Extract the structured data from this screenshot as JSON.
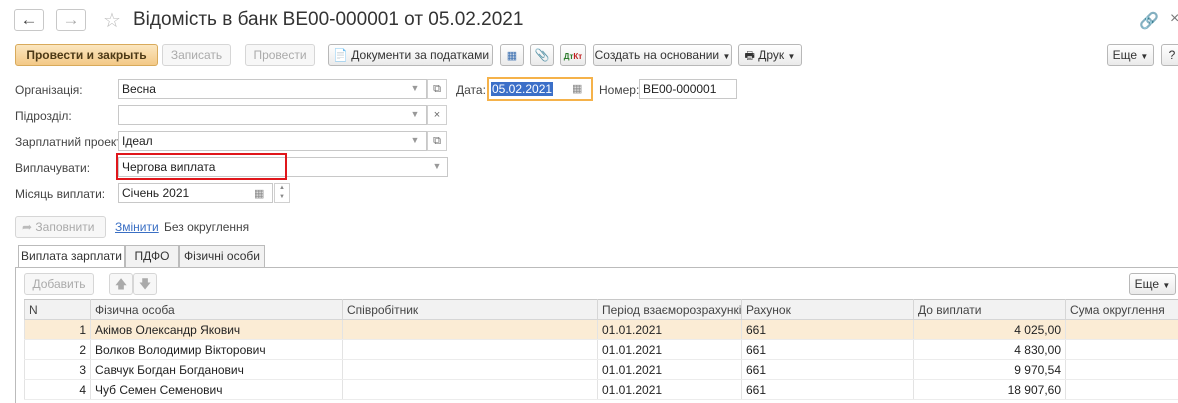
{
  "window": {
    "title": "Відомість в банк ВЕ00-000001 от 05.02.2021"
  },
  "toolbar": {
    "post_close": "Провести и закрыть",
    "save": "Записать",
    "post": "Провести",
    "tax_docs": "Документи за податками",
    "create_based": "Создать на основании",
    "print": "Друк",
    "more": "Еще",
    "help": "?"
  },
  "form": {
    "org_label": "Організація:",
    "org_value": "Весна",
    "date_label": "Дата:",
    "date_value": "05.02.2021",
    "number_label": "Номер:",
    "number_value": "ВЕ00-000001",
    "dept_label": "Підрозділ:",
    "dept_value": "",
    "project_label": "Зарплатний проект:",
    "project_value": "Ідеал",
    "pay_label": "Виплачувати:",
    "pay_value": "Чергова виплата",
    "month_label": "Місяць виплати:",
    "month_value": "Січень 2021"
  },
  "fill": {
    "fill_button": "Заповнити",
    "change_link": "Змінити",
    "rounding_text": "Без округлення"
  },
  "tabs": [
    "Виплата зарплати",
    "ПДФО",
    "Фізичні особи"
  ],
  "table_toolbar": {
    "add": "Добавить",
    "more": "Еще"
  },
  "table": {
    "columns": [
      "N",
      "Фізична особа",
      "Співробітник",
      "Період взаєморозрахунків",
      "Рахунок",
      "До виплати",
      "Сума округлення"
    ],
    "rows": [
      [
        "1",
        "Акімов Олександр Якович",
        "",
        "01.01.2021",
        "661",
        "4 025,00",
        ""
      ],
      [
        "2",
        "Волков Володимир Вікторович",
        "",
        "01.01.2021",
        "661",
        "4 830,00",
        ""
      ],
      [
        "3",
        "Савчук Богдан Богданович",
        "",
        "01.01.2021",
        "661",
        "9 970,54",
        ""
      ],
      [
        "4",
        "Чуб Семен Семенович",
        "",
        "01.01.2021",
        "661",
        "18 907,60",
        ""
      ]
    ]
  },
  "colors": {
    "primary_button": "#f3c987",
    "highlight_box": "#e0161b",
    "selected_row": "#fbecd5",
    "date_focus": "#f5b24a",
    "link": "#3a6fc4"
  }
}
